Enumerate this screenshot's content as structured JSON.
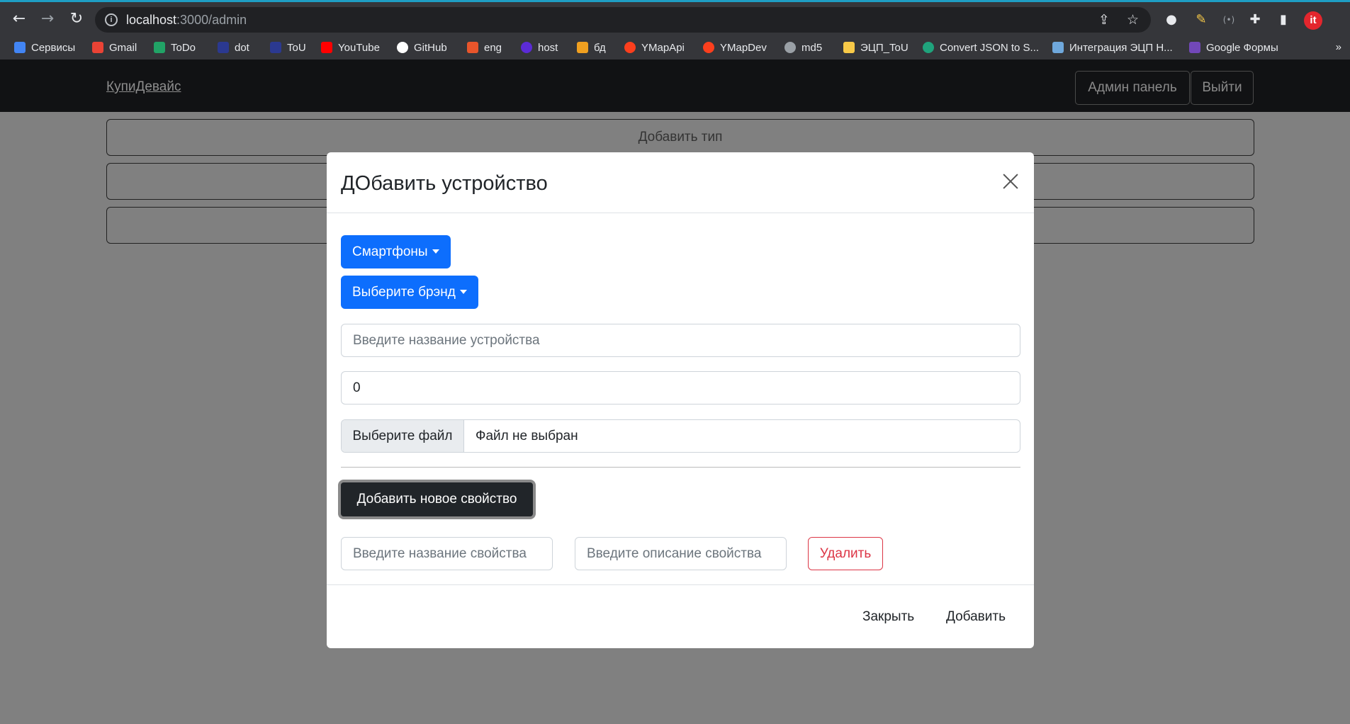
{
  "browser": {
    "url_host": "localhost",
    "url_path": ":3000/admin",
    "bookmarks": [
      {
        "label": "Сервисы",
        "color": "#4285f4"
      },
      {
        "label": "Gmail",
        "color": "#ea4335"
      },
      {
        "label": "ToDo",
        "color": "#21a366"
      },
      {
        "label": "dot",
        "color": "#2b3990"
      },
      {
        "label": "ToU",
        "color": "#2b3990"
      },
      {
        "label": "YouTube",
        "color": "#ff0000"
      },
      {
        "label": "GitHub",
        "color": "#ffffff"
      },
      {
        "label": "eng",
        "color": "#e8552b"
      },
      {
        "label": "host",
        "color": "#5b2bd6"
      },
      {
        "label": "бд",
        "color": "#f0a020"
      },
      {
        "label": "YMapApi",
        "color": "#fc3f1d"
      },
      {
        "label": "YMapDev",
        "color": "#fc3f1d"
      },
      {
        "label": "md5",
        "color": "#9aa0a6"
      },
      {
        "label": "ЭЦП_ToU",
        "color": "#f7c948"
      },
      {
        "label": "Convert JSON to S...",
        "color": "#1fa37c"
      },
      {
        "label": "Интеграция ЭЦП Н...",
        "color": "#6fa8dc"
      },
      {
        "label": "Google Формы",
        "color": "#7248b9"
      }
    ],
    "more_bookmarks": "»"
  },
  "navbar": {
    "brand": "КупиДевайс",
    "admin_panel": "Админ панель",
    "logout": "Выйти"
  },
  "page": {
    "add_type": "Добавить тип",
    "add_brand": "",
    "add_device": ""
  },
  "modal": {
    "title": "ДОбавить устройство",
    "type_dropdown": "Смартфоны",
    "brand_dropdown": "Выберите брэнд",
    "name_placeholder": "Введите название устройства",
    "price_value": "0",
    "file_button": "Выберите файл",
    "file_status": "Файл не выбран",
    "add_property": "Добавить новое свойство",
    "property_name_placeholder": "Введите название свойства",
    "property_desc_placeholder": "Введите описание свойства",
    "delete": "Удалить",
    "close": "Закрыть",
    "submit": "Добавить"
  }
}
